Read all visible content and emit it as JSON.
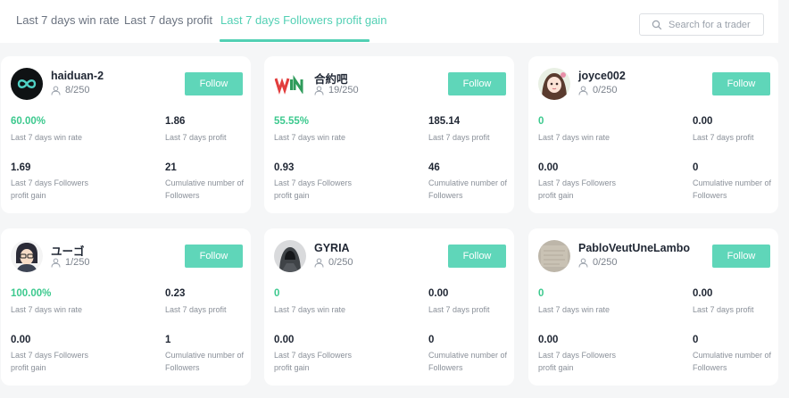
{
  "tabs": [
    {
      "label": "Last 7 days win rate",
      "active": false
    },
    {
      "label": "Last 7 days profit",
      "active": false
    },
    {
      "label": "Last 7 days Followers profit gain",
      "active": true
    }
  ],
  "search": {
    "placeholder": "Search for a trader"
  },
  "colors": {
    "accent": "#52d0b4",
    "button": "#5fd6b9",
    "positive": "#3cc98e"
  },
  "labels": {
    "win_rate": "Last 7 days win rate",
    "profit": "Last 7 days profit",
    "followers_gain": "Last 7 days Followers profit gain",
    "cumulative": "Cumulative number of Followers",
    "follow": "Follow"
  },
  "traders": [
    {
      "name": "haiduan-2",
      "followers": "8/250",
      "avatar": "infinity-logo-avatar",
      "win_rate": "60.00%",
      "profit": "1.86",
      "followers_gain": "1.69",
      "cumulative": "21"
    },
    {
      "name": "合約吧",
      "followers": "19/250",
      "avatar": "win-logo-avatar",
      "win_rate": "55.55%",
      "profit": "185.14",
      "followers_gain": "0.93",
      "cumulative": "46"
    },
    {
      "name": "joyce002",
      "followers": "0/250",
      "avatar": "anime-girl-avatar",
      "win_rate": "0",
      "profit": "0.00",
      "followers_gain": "0.00",
      "cumulative": "0"
    },
    {
      "name": "ユーゴ",
      "followers": "1/250",
      "avatar": "anime-boy-avatar",
      "win_rate": "100.00%",
      "profit": "0.23",
      "followers_gain": "0.00",
      "cumulative": "1"
    },
    {
      "name": "GYRIA",
      "followers": "0/250",
      "avatar": "hooded-figure-avatar",
      "win_rate": "0",
      "profit": "0.00",
      "followers_gain": "0.00",
      "cumulative": "0"
    },
    {
      "name": "PabloVeutUneLambo",
      "followers": "0/250",
      "avatar": "paper-texture-avatar",
      "win_rate": "0",
      "profit": "0.00",
      "followers_gain": "0.00",
      "cumulative": "0"
    }
  ]
}
